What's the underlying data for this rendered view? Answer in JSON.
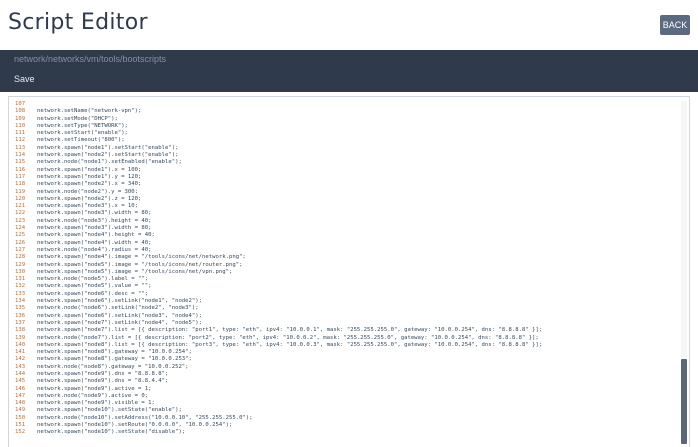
{
  "header": {
    "title": "Script Editor",
    "back_label": "BACK"
  },
  "breadcrumb": {
    "path": "network/networks/vm/tools/bootscripts"
  },
  "toolbar": {
    "save_label": "Save"
  },
  "editor": {
    "lines": [
      {
        "n": "107",
        "text": ""
      },
      {
        "n": "108",
        "text": "network.setName(\"network-vpn\");"
      },
      {
        "n": "109",
        "text": "network.setMode(\"DHCP\");"
      },
      {
        "n": "110",
        "text": "network.setType(\"NETWORK\");"
      },
      {
        "n": "111",
        "text": "network.setStart(\"enable\");"
      },
      {
        "n": "112",
        "text": "network.setTimeout(\"800\");"
      },
      {
        "n": "113",
        "text": "network.spawn(\"node1\").setStart(\"enable\");"
      },
      {
        "n": "114",
        "text": "network.spawn(\"node2\").setStart(\"enable\");"
      },
      {
        "n": "115",
        "text": "network.node(\"node1\").setEnabled(\"enable\");"
      },
      {
        "n": "116",
        "text": "network.spawn(\"node1\").x = 100;"
      },
      {
        "n": "117",
        "text": "network.spawn(\"node1\").y = 120;"
      },
      {
        "n": "118",
        "text": "network.spawn(\"node2\").x = 340;"
      },
      {
        "n": "119",
        "text": "network.node(\"node2\").y = 300;"
      },
      {
        "n": "120",
        "text": "network.spawn(\"node2\").z = 120;"
      },
      {
        "n": "121",
        "text": "network.spawn(\"node3\").x = 10;"
      },
      {
        "n": "122",
        "text": "network.spawn(\"node3\").width = 80;"
      },
      {
        "n": "123",
        "text": "network.node(\"node3\").height = 40;"
      },
      {
        "n": "124",
        "text": "network.spawn(\"node3\").width = 80;"
      },
      {
        "n": "125",
        "text": "network.spawn(\"node4\").height = 40;"
      },
      {
        "n": "126",
        "text": "network.spawn(\"node4\").width = 40;"
      },
      {
        "n": "127",
        "text": "network.node(\"node4\").radius = 40;"
      },
      {
        "n": "128",
        "text": "network.spawn(\"node4\").image = \"/tools/icons/net/network.png\";"
      },
      {
        "n": "129",
        "text": "network.spawn(\"node5\").image = \"/tools/icons/net/router.png\";"
      },
      {
        "n": "130",
        "text": "network.spawn(\"node5\").image = \"/tools/icons/net/vpn.png\";"
      },
      {
        "n": "131",
        "text": "network.node(\"node5\").label = \"\";"
      },
      {
        "n": "132",
        "text": "network.spawn(\"node5\").value = \"\";"
      },
      {
        "n": "133",
        "text": "network.spawn(\"node6\").desc = \"\";"
      },
      {
        "n": "134",
        "text": "network.spawn(\"node6\").setLink(\"node1\", \"node2\");"
      },
      {
        "n": "135",
        "text": "network.node(\"node6\").setLink(\"node2\", \"node3\");"
      },
      {
        "n": "136",
        "text": "network.spawn(\"node6\").setLink(\"node3\", \"node4\");"
      },
      {
        "n": "137",
        "text": "network.spawn(\"node7\").setLink(\"node4\", \"node5\");"
      },
      {
        "n": "138",
        "text": "network.spawn(\"node7\").list = [{ description: \"port1\", type: \"eth\", ipv4: \"10.0.0.1\", mask: \"255.255.255.0\", gateway: \"10.0.0.254\", dns: \"8.8.8.8\" }];"
      },
      {
        "n": "139",
        "text": "network.node(\"node7\").list = [{ description: \"port2\", type: \"eth\", ipv4: \"10.0.0.2\", mask: \"255.255.255.0\", gateway: \"10.0.0.254\", dns: \"8.8.8.8\" }];"
      },
      {
        "n": "140",
        "text": "network.spawn(\"node8\").list = [{ description: \"port3\", type: \"eth\", ipv4: \"10.0.0.3\", mask: \"255.255.255.0\", gateway: \"10.0.0.254\", dns: \"8.8.8.8\" }];"
      },
      {
        "n": "141",
        "text": "network.spawn(\"node8\").gateway = \"10.0.0.254\";"
      },
      {
        "n": "142",
        "text": "network.spawn(\"node8\").gateway = \"10.0.0.253\";"
      },
      {
        "n": "143",
        "text": "network.node(\"node8\").gateway = \"10.0.0.252\";"
      },
      {
        "n": "144",
        "text": "network.spawn(\"node9\").dns = \"8.8.8.8\";"
      },
      {
        "n": "145",
        "text": "network.spawn(\"node9\").dns = \"8.8.4.4\";"
      },
      {
        "n": "146",
        "text": "network.spawn(\"node9\").active = 1;"
      },
      {
        "n": "147",
        "text": "network.node(\"node9\").active = 0;"
      },
      {
        "n": "148",
        "text": "network.spawn(\"node9\").visible = 1;"
      },
      {
        "n": "149",
        "text": "network.spawn(\"node10\").setState(\"enable\");"
      },
      {
        "n": "150",
        "text": "network.node(\"node10\").setAddress(\"10.0.0.10\", \"255.255.255.0\");"
      },
      {
        "n": "151",
        "text": "network.spawn(\"node10\").setRoute(\"0.0.0.0\", \"10.0.0.254\");"
      },
      {
        "n": "152",
        "text": "network.spawn(\"node10\").setState(\"disable\");"
      }
    ]
  },
  "colors": {
    "title_bar_bg": "#ffffff",
    "path_bar_bg": "#2f3a4a",
    "back_button_bg": "#5c6a7f",
    "line_number": "#c96b2f",
    "code_text": "#34495e"
  }
}
